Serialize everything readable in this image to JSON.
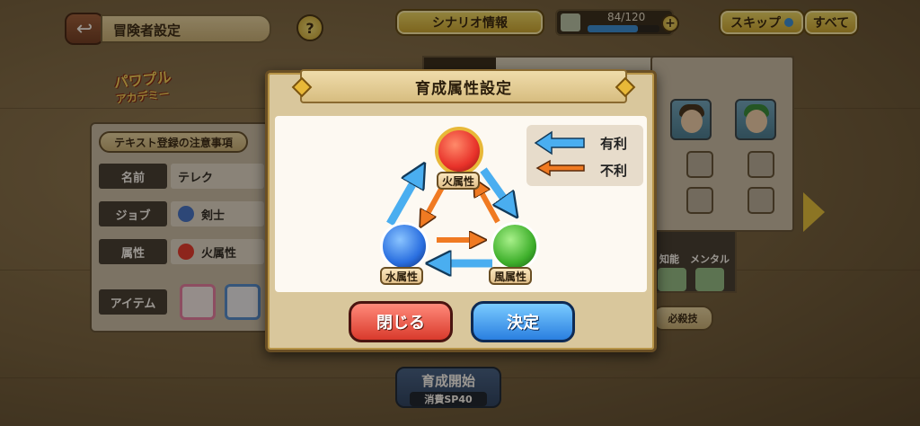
{
  "header": {
    "title": "冒険者設定",
    "help_label": "?",
    "scenario_label": "シナリオ情報",
    "stamina_text": "84/120",
    "stamina_fraction": 0.7,
    "plus_label": "+",
    "skip_label": "スキップ",
    "all_label": "すべて"
  },
  "logo": {
    "line1": "パワプル",
    "line2": "アカデミー"
  },
  "left_panel": {
    "notice_label": "テキスト登録の注意事項",
    "rows": [
      {
        "label": "名前",
        "value": "テレク"
      },
      {
        "label": "ジョブ",
        "value": "剣士"
      },
      {
        "label": "属性",
        "value": "火属性"
      },
      {
        "label": "アイテム",
        "value": ""
      }
    ]
  },
  "right_panel": {
    "stats": [
      "知能",
      "メンタル"
    ],
    "special_label": "必殺技"
  },
  "start": {
    "label": "育成開始",
    "cost": "消費SP40"
  },
  "modal": {
    "title": "育成属性設定",
    "legend": {
      "advantage": "有利",
      "disadvantage": "不利"
    },
    "elements": {
      "fire": "火属性",
      "water": "水属性",
      "wind": "風属性"
    },
    "close_label": "閉じる",
    "confirm_label": "決定"
  },
  "colors": {
    "advantage_arrow": "#4aaef0",
    "disadvantage_arrow": "#f07a22",
    "fire": "#e8322a",
    "water": "#2a6fe0",
    "wind": "#3fb02c",
    "close_button": "#e0463a",
    "confirm_button": "#2f88e6"
  }
}
